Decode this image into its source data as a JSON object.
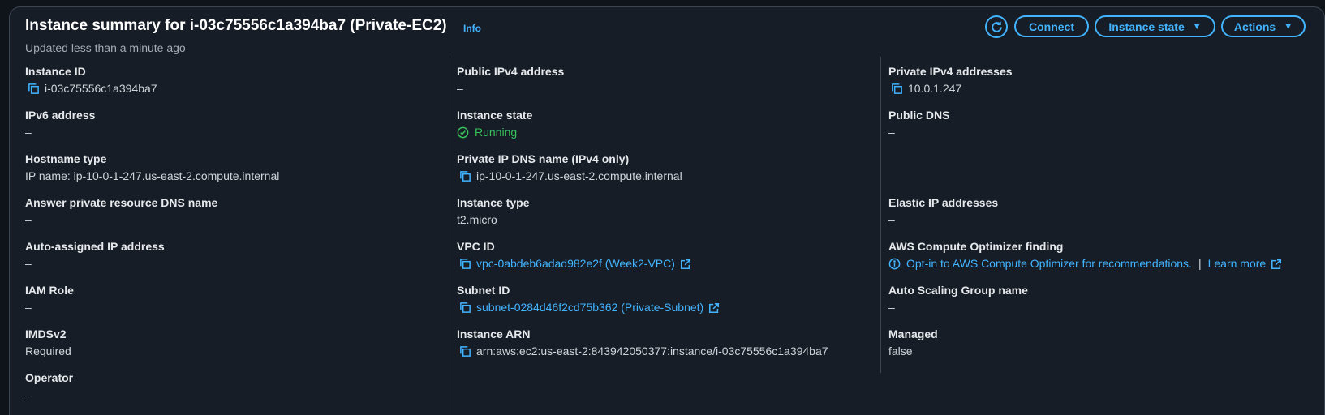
{
  "header": {
    "title": "Instance summary for i-03c75556c1a394ba7 (Private-EC2)",
    "info_label": "Info",
    "updated": "Updated less than a minute ago"
  },
  "buttons": {
    "connect": "Connect",
    "instance_state": "Instance state",
    "actions": "Actions"
  },
  "col1": {
    "instance_id": {
      "label": "Instance ID",
      "value": "i-03c75556c1a394ba7"
    },
    "ipv6": {
      "label": "IPv6 address",
      "value": "–"
    },
    "hostname_type": {
      "label": "Hostname type",
      "value": "IP name: ip-10-0-1-247.us-east-2.compute.internal"
    },
    "answer_dns": {
      "label": "Answer private resource DNS name",
      "value": "–"
    },
    "auto_ip": {
      "label": "Auto-assigned IP address",
      "value": "–"
    },
    "iam_role": {
      "label": "IAM Role",
      "value": "–"
    },
    "imdsv2": {
      "label": "IMDSv2",
      "value": "Required"
    },
    "operator": {
      "label": "Operator",
      "value": "–"
    }
  },
  "col2": {
    "public_ipv4": {
      "label": "Public IPv4 address",
      "value": "–"
    },
    "instance_state": {
      "label": "Instance state",
      "value": "Running"
    },
    "private_dns": {
      "label": "Private IP DNS name (IPv4 only)",
      "value": "ip-10-0-1-247.us-east-2.compute.internal"
    },
    "instance_type": {
      "label": "Instance type",
      "value": "t2.micro"
    },
    "vpc_id": {
      "label": "VPC ID",
      "value": "vpc-0abdeb6adad982e2f (Week2-VPC)"
    },
    "subnet_id": {
      "label": "Subnet ID",
      "value": "subnet-0284d46f2cd75b362 (Private-Subnet)"
    },
    "instance_arn": {
      "label": "Instance ARN",
      "value": "arn:aws:ec2:us-east-2:843942050377:instance/i-03c75556c1a394ba7"
    }
  },
  "col3": {
    "private_ipv4": {
      "label": "Private IPv4 addresses",
      "value": "10.0.1.247"
    },
    "public_dns": {
      "label": "Public DNS",
      "value": "–"
    },
    "elastic_ip": {
      "label": "Elastic IP addresses",
      "value": "–"
    },
    "optimizer": {
      "label": "AWS Compute Optimizer finding",
      "value": "Opt-in to AWS Compute Optimizer for recommendations.",
      "learn_more": "Learn more",
      "separator": "|"
    },
    "asg_name": {
      "label": "Auto Scaling Group name",
      "value": "–"
    },
    "managed": {
      "label": "Managed",
      "value": "false"
    }
  },
  "colors": {
    "accent": "#42b4ff",
    "running": "#35c35a",
    "panel_bg": "#161d26",
    "page_bg": "#0f141a"
  }
}
